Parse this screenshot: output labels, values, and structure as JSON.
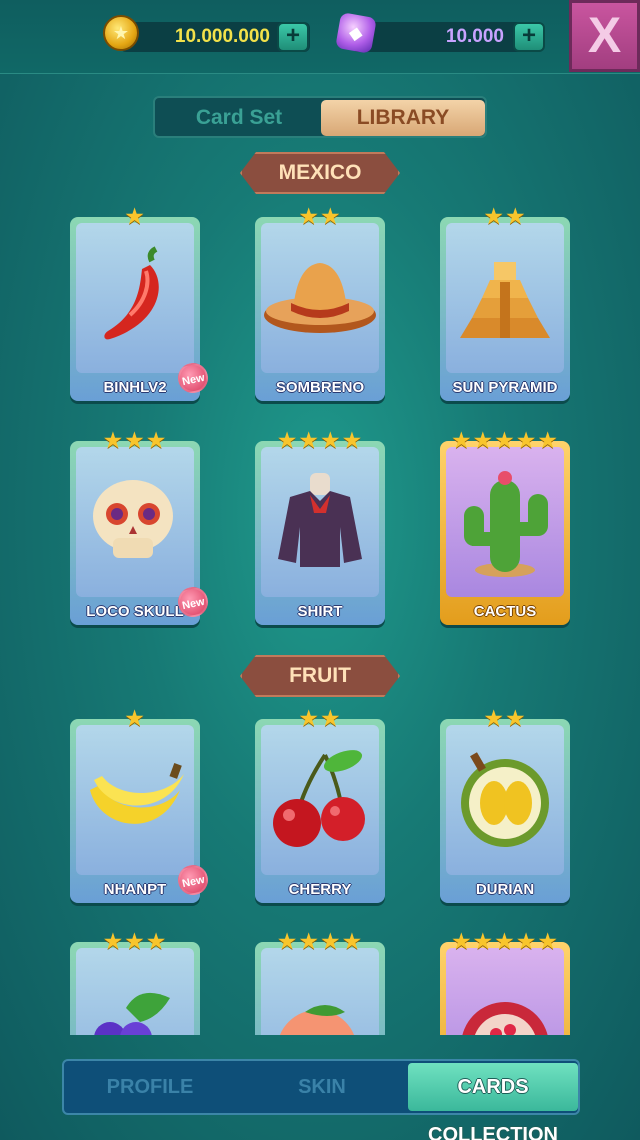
{
  "currency": {
    "coins": "10.000.000",
    "gems": "10.000",
    "add_label": "+"
  },
  "close_label": "X",
  "tabs": {
    "card_set": "Card Set",
    "library": "LIBRARY",
    "active": "LIBRARY"
  },
  "sections": [
    {
      "title": "MEXICO",
      "cards": [
        {
          "name": "BINHLV2",
          "stars": 1,
          "new": true,
          "icon": "chili-pepper-icon"
        },
        {
          "name": "SOMBRENO",
          "stars": 2,
          "new": false,
          "icon": "sombrero-icon"
        },
        {
          "name": "SUN PYRAMID",
          "stars": 2,
          "new": false,
          "icon": "pyramid-icon"
        },
        {
          "name": "LOCO SKULL",
          "stars": 3,
          "new": true,
          "icon": "skull-icon"
        },
        {
          "name": "SHIRT",
          "stars": 4,
          "new": false,
          "icon": "shirt-icon"
        },
        {
          "name": "CACTUS",
          "stars": 5,
          "new": false,
          "icon": "cactus-icon",
          "gold": true
        }
      ]
    },
    {
      "title": "FRUIT",
      "cards": [
        {
          "name": "NHANPT",
          "stars": 1,
          "new": true,
          "icon": "banana-icon"
        },
        {
          "name": "CHERRY",
          "stars": 2,
          "new": false,
          "icon": "cherry-icon"
        },
        {
          "name": "DURIAN",
          "stars": 2,
          "new": false,
          "icon": "durian-icon"
        },
        {
          "name": "",
          "stars": 3,
          "new": false,
          "icon": "grapes-icon"
        },
        {
          "name": "",
          "stars": 4,
          "new": false,
          "icon": "peach-icon"
        },
        {
          "name": "",
          "stars": 5,
          "new": false,
          "icon": "pomegranate-icon",
          "gold": true
        }
      ]
    }
  ],
  "new_badge_label": "New",
  "bottom_tabs": {
    "profile": "PROFILE",
    "skin": "SKIN",
    "cards_collection": "CARDS COLLECTION",
    "active": "CARDS COLLECTION"
  },
  "colors": {
    "coin_text": "#f2e14a",
    "gem_text": "#c8a3ff",
    "star": "#f8c52c",
    "section_banner": "#8b4e3f"
  }
}
